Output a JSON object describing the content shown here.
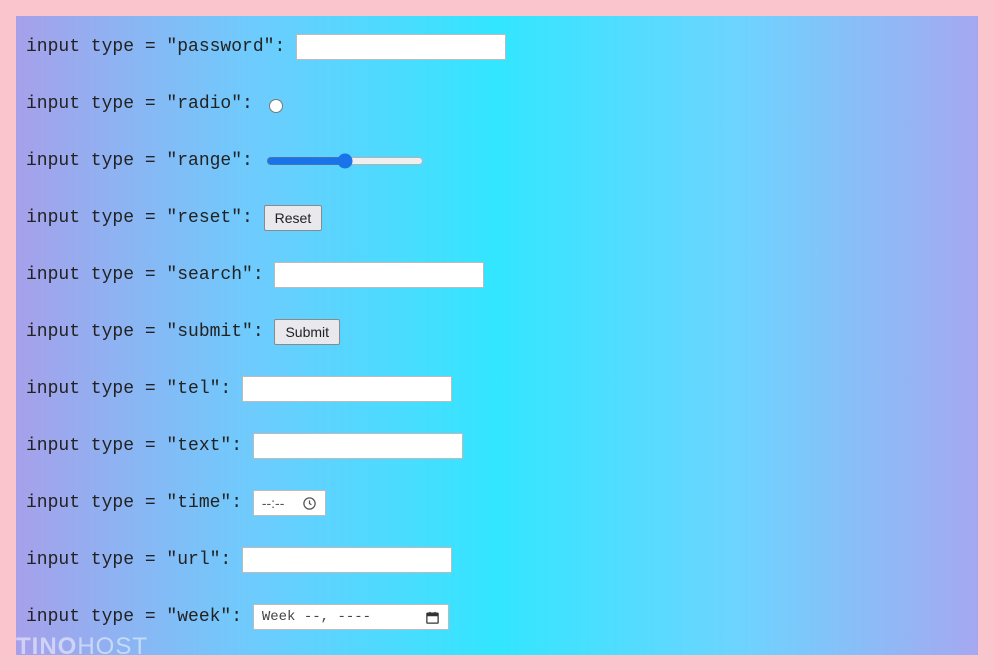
{
  "rows": {
    "password": {
      "label": "input type = \"password\": "
    },
    "radio": {
      "label": "input type = \"radio\": "
    },
    "range": {
      "label": "input type = \"range\": ",
      "value": 50,
      "min": 0,
      "max": 100
    },
    "reset": {
      "label": "input type = \"reset\": ",
      "button": "Reset"
    },
    "search": {
      "label": "input type = \"search\": "
    },
    "submit": {
      "label": "input type = \"submit\": ",
      "button": "Submit"
    },
    "tel": {
      "label": "input type = \"tel\": "
    },
    "text": {
      "label": "input type = \"text\": "
    },
    "time": {
      "label": "input type = \"time\": ",
      "placeholder": "--:--"
    },
    "url": {
      "label": "input type = \"url\": "
    },
    "week": {
      "label": "input type = \"week\": ",
      "placeholder": "Week --, ----"
    }
  },
  "watermark": {
    "bold": "TINO",
    "light": "HOST"
  }
}
